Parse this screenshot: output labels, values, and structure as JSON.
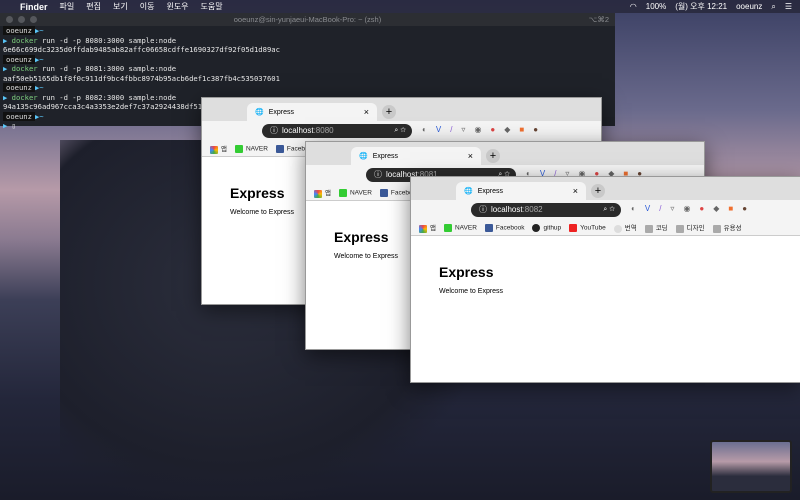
{
  "menubar": {
    "app": "Finder",
    "items": [
      "파일",
      "편집",
      "보기",
      "이동",
      "윈도우",
      "도움말"
    ],
    "battery": "100%",
    "clock": "(월) 오후 12:21",
    "user": "ooeunz"
  },
  "terminal": {
    "title": "ooeunz@sin-yunjaeui-MacBook-Pro: ~ (zsh)",
    "shortcut": "⌥⌘2",
    "prompt_user": "ooeunz",
    "lines": [
      {
        "cmd": "docker",
        "args": " run -d -p 8080:3000 sample:node",
        "out": "6e66c699dc3235d0ffdab9485ab82affc06658cdffe1690327df92f05d1d89ac"
      },
      {
        "cmd": "docker",
        "args": " run -d -p 8081:3000 sample:node",
        "out": "aaf50eb5165db1f8f0c911df9bc4fbbc8974b95acb6def1c387fb4c535037601"
      },
      {
        "cmd": "docker",
        "args": " run -d -p 8082:3000 sample:node",
        "out": "94a135c96ad967cca3c4a3353e2def7c37a2924438df51778e0"
      }
    ]
  },
  "browsers": [
    {
      "tab": "Express",
      "host": "localhost",
      "port": ":8080",
      "heading": "Express",
      "text": "Welcome to Express"
    },
    {
      "tab": "Express",
      "host": "localhost",
      "port": ":8081",
      "heading": "Express",
      "text": "Welcome to Express"
    },
    {
      "tab": "Express",
      "host": "localhost",
      "port": ":8082",
      "heading": "Express",
      "text": "Welcome to Express"
    }
  ],
  "bookmarks": [
    "앱",
    "NAVER",
    "Facebook",
    "githup",
    "YouTube",
    "번역",
    "코딩",
    "디자인",
    "유용성"
  ]
}
